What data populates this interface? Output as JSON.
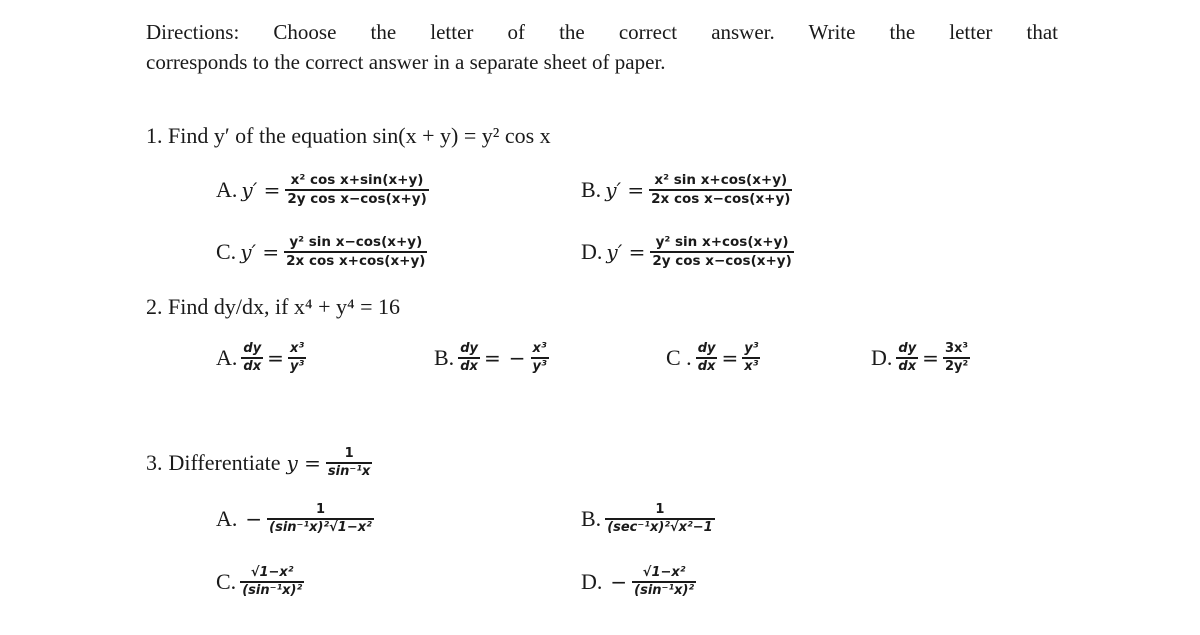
{
  "directions": {
    "line1": "Directions:  Choose  the  letter  of  the  correct  answer.  Write  the  letter  that",
    "line2": "corresponds to the correct answer in a separate sheet of paper."
  },
  "questions": [
    {
      "number": "1.",
      "prompt": "Find y′ of the equation sin(x + y) = y² cos x",
      "lhs": "y′ =",
      "options": [
        {
          "letter": "A.",
          "sign": "",
          "numerator": "x² cos x+sin(x+y)",
          "denominator": "2y cos x−cos(x+y)"
        },
        {
          "letter": "B.",
          "sign": "",
          "numerator": "x² sin x+cos(x+y)",
          "denominator": "2x cos x−cos(x+y)"
        },
        {
          "letter": "C.",
          "sign": "",
          "numerator": "y² sin x−cos(x+y)",
          "denominator": "2x cos x+cos(x+y)"
        },
        {
          "letter": "D.",
          "sign": "",
          "numerator": "y² sin x+cos(x+y)",
          "denominator": "2y cos x−cos(x+y)"
        }
      ]
    },
    {
      "number": "2.",
      "prompt": "Find dy/dx, if x⁴ + y⁴ = 16",
      "options": [
        {
          "letter": "A.",
          "sign": "",
          "numerator": "x³",
          "denominator": "y³"
        },
        {
          "letter": "B.",
          "sign": "−",
          "numerator": "x³",
          "denominator": "y³"
        },
        {
          "letter": "C .",
          "sign": "",
          "numerator": "y³",
          "denominator": "x³"
        },
        {
          "letter": "D.",
          "sign": "",
          "numerator": "3x³",
          "denominator": "2y²"
        }
      ],
      "lhs_numerator": "dy",
      "lhs_denominator": "dx"
    },
    {
      "number": "3.",
      "prompt_text": "Differentiate",
      "prompt_lhs": "y =",
      "prompt_numerator": "1",
      "prompt_denominator": "sin⁻¹x",
      "options": [
        {
          "letter": "A.",
          "sign": "−",
          "numerator": "1",
          "denominator": "(sin⁻¹x)²√1−x²"
        },
        {
          "letter": "B.",
          "sign": "",
          "numerator": "1",
          "denominator": "(sec⁻¹x)²√x²−1"
        },
        {
          "letter": "C.",
          "sign": "",
          "numerator": "√1−x²",
          "denominator": "(sin⁻¹x)²"
        },
        {
          "letter": "D.",
          "sign": "−",
          "numerator": "√1−x²",
          "denominator": "(sin⁻¹x)²"
        }
      ]
    }
  ]
}
